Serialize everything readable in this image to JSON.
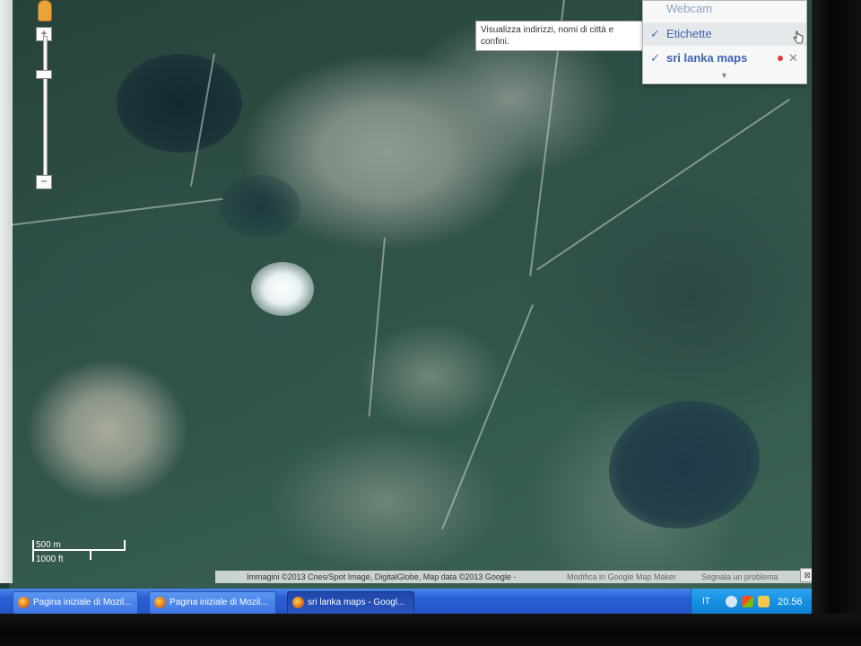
{
  "tooltip": {
    "text": "Visualizza indirizzi, nomi di città e confini."
  },
  "layers": {
    "items": [
      {
        "label": "Webcam",
        "checked": false
      },
      {
        "label": "Etichette",
        "checked": true
      },
      {
        "label": "sri lanka maps",
        "checked": true
      }
    ],
    "check_glyph": "✓",
    "close_glyph": "✕",
    "more_glyph": "▼"
  },
  "zoom": {
    "in_label": "+",
    "out_label": "−"
  },
  "scale": {
    "metric": "500 m",
    "imperial": "1000 ft"
  },
  "attribution": {
    "imagery": "Immagini ©2013 Cnes/Spot Image, DigitalGlobe, Map data ©2013 Google -",
    "edit_link": "Modifica in Google Map Maker",
    "report_link": "Segnala un problema"
  },
  "taskbar": {
    "buttons": [
      {
        "label": "Pagina iniziale di Mozil...",
        "active": false
      },
      {
        "label": "Pagina iniziale di Mozil...",
        "active": false
      },
      {
        "label": "sri lanka maps - Googl...",
        "active": true
      }
    ],
    "language": "IT",
    "clock": "20.56"
  }
}
